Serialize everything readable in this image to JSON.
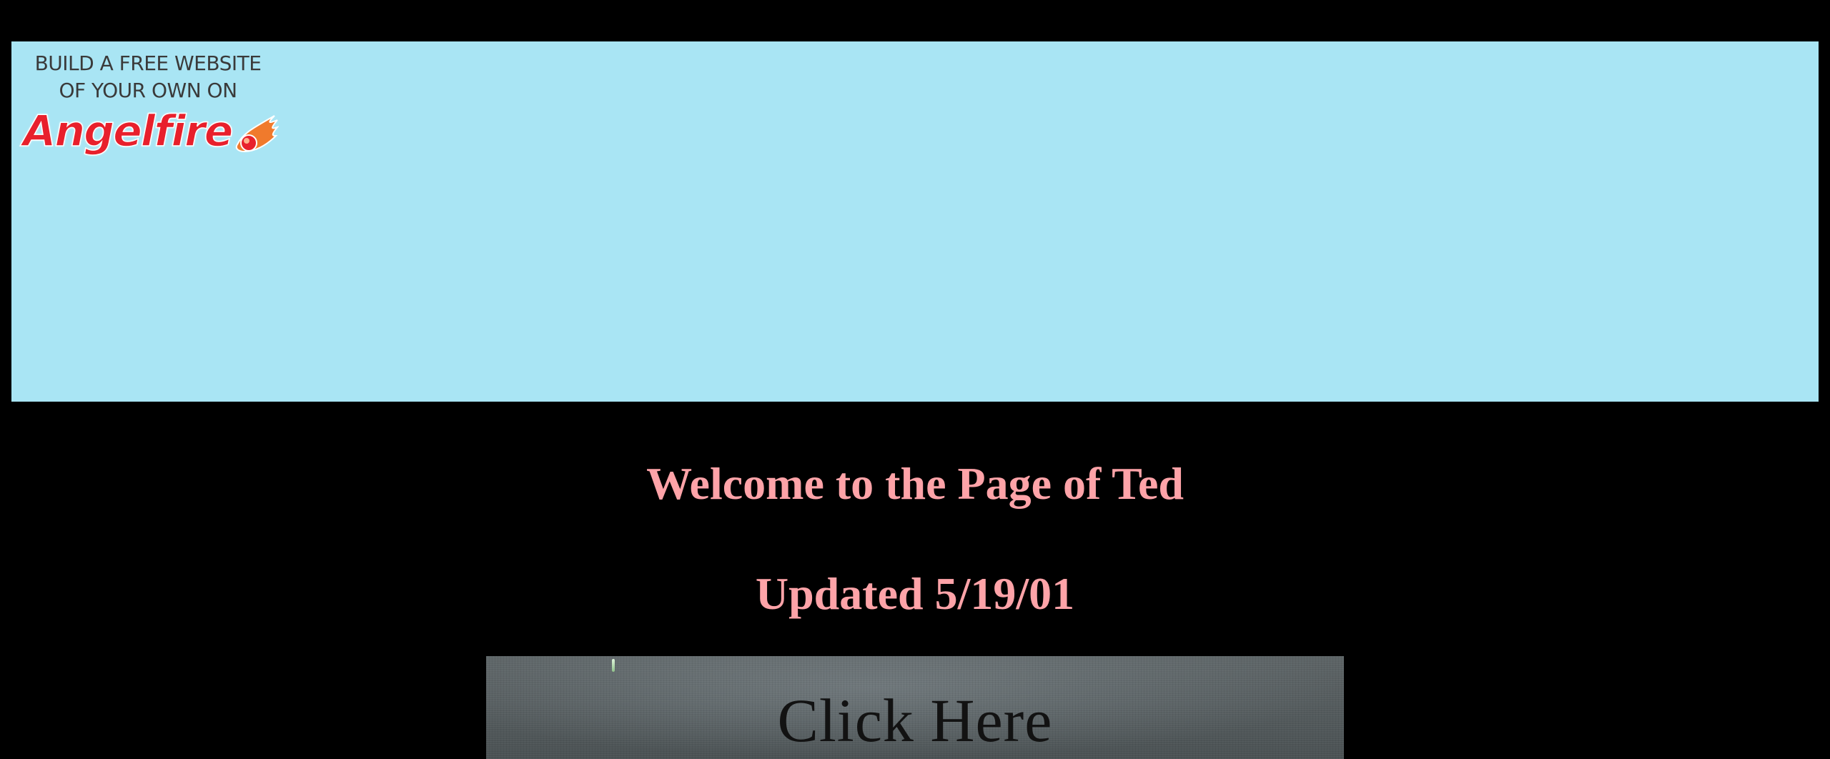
{
  "ad": {
    "line1": "BUILD A FREE WEBSITE",
    "line2": "OF YOUR OWN ON",
    "logo_text": "Angelfire",
    "flame_icon": "flame-icon",
    "banner_color": "#a9e5f4",
    "logo_color": "#e8202c"
  },
  "main": {
    "welcome": "Welcome to the Page of Ted",
    "updated": "Updated 5/19/01",
    "heading_color": "#fea3a8",
    "click_image_text": "Click Here"
  }
}
